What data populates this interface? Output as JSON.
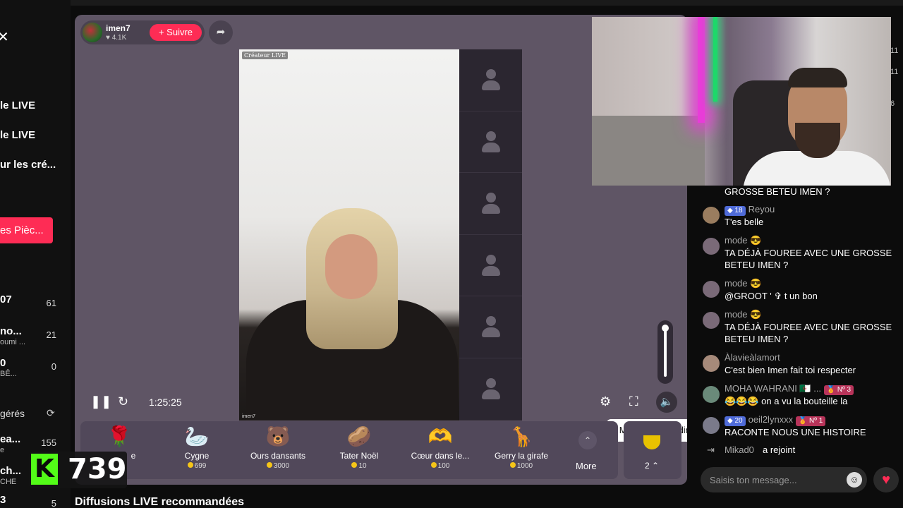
{
  "sidebar": {
    "links": [
      "le LIVE",
      "le LIVE",
      "ur les cré..."
    ],
    "coins_button": "es Pièc...",
    "rows": [
      {
        "name": "07",
        "sub": "",
        "count": "61"
      },
      {
        "name": "no...",
        "sub": "oumi ...",
        "count": "21"
      },
      {
        "name": "0",
        "sub": "BÊ...",
        "count": "0"
      },
      {
        "name": "ea...",
        "sub": "e",
        "count": "155"
      },
      {
        "name": "ch...",
        "sub": "CHE",
        "count": ""
      },
      {
        "name": "3",
        "sub": "",
        "count": "5"
      }
    ],
    "suggested_label": "gérés",
    "recommended_title": "Diffusions LIVE recommandées"
  },
  "kick_overlay": {
    "logo": "K",
    "viewers": "739"
  },
  "player": {
    "host": {
      "name": "imen7",
      "likes": "4.1K",
      "follow_label": "+ Suivre"
    },
    "video_tag": "Créateur LIVE",
    "video_watermark": "imen7",
    "time": "1:25:25",
    "volume_level": 1.0,
    "tooltip": "Mettre en sourdine (M)",
    "guest_slots": 6
  },
  "gifts": {
    "items": [
      {
        "icon": "rose-icon",
        "glyph": "🌹",
        "name": "e",
        "price": ""
      },
      {
        "icon": "swan-icon",
        "glyph": "🦢",
        "name": "Cygne",
        "price": "699"
      },
      {
        "icon": "dancing-bears-icon",
        "glyph": "🐻",
        "name": "Ours dansants",
        "price": "3000"
      },
      {
        "icon": "tater-icon",
        "glyph": "🥔",
        "name": "Tater Noël",
        "price": "10"
      },
      {
        "icon": "heart-hands-icon",
        "glyph": "🫶",
        "name": "Cœur dans le...",
        "price": "100"
      },
      {
        "icon": "giraffe-icon",
        "glyph": "🦒",
        "name": "Gerry la girafe",
        "price": "1000"
      }
    ],
    "more_label": "More",
    "rank_label": "2"
  },
  "chat": {
    "messages": [
      {
        "name": "",
        "badges": [],
        "text": "GROSSE BETEU IMEN ?"
      },
      {
        "name": "Reyou",
        "badges": [
          {
            "text": "18",
            "kind": "blue"
          }
        ],
        "text": "T'es belle"
      },
      {
        "name": "mode 😎",
        "badges": [],
        "text": "TA DÉJÀ FOUREE AVEC UNE GROSSE BETEU IMEN ?"
      },
      {
        "name": "mode 😎",
        "badges": [],
        "text": "@GROOT ' ✞ t un bon"
      },
      {
        "name": "mode 😎",
        "badges": [],
        "text": "TA DÉJÀ FOUREE AVEC UNE GROSSE BETEU IMEN ?"
      },
      {
        "name": "Àlavieàlamort",
        "badges": [],
        "text": "C'est bien Imen fait toi respecter"
      },
      {
        "name": "MOHA WAHRANI 🇩🇿 ...",
        "badges": [
          {
            "text": "Nº 3",
            "kind": "red"
          }
        ],
        "text": "😂😂😂 on a vu la bouteille la"
      },
      {
        "name": "oeil2lynxxx",
        "badges": [
          {
            "text": "20",
            "kind": "blue"
          },
          {
            "text": "Nº 1",
            "kind": "red"
          }
        ],
        "text": "RACONTE NOUS UNE HISTOIRE"
      }
    ],
    "join": {
      "name": "Mikad0",
      "text": "a rejoint"
    },
    "input_placeholder": "Saisis ton message...",
    "edge_numbers": [
      "11",
      "11",
      "6"
    ]
  }
}
